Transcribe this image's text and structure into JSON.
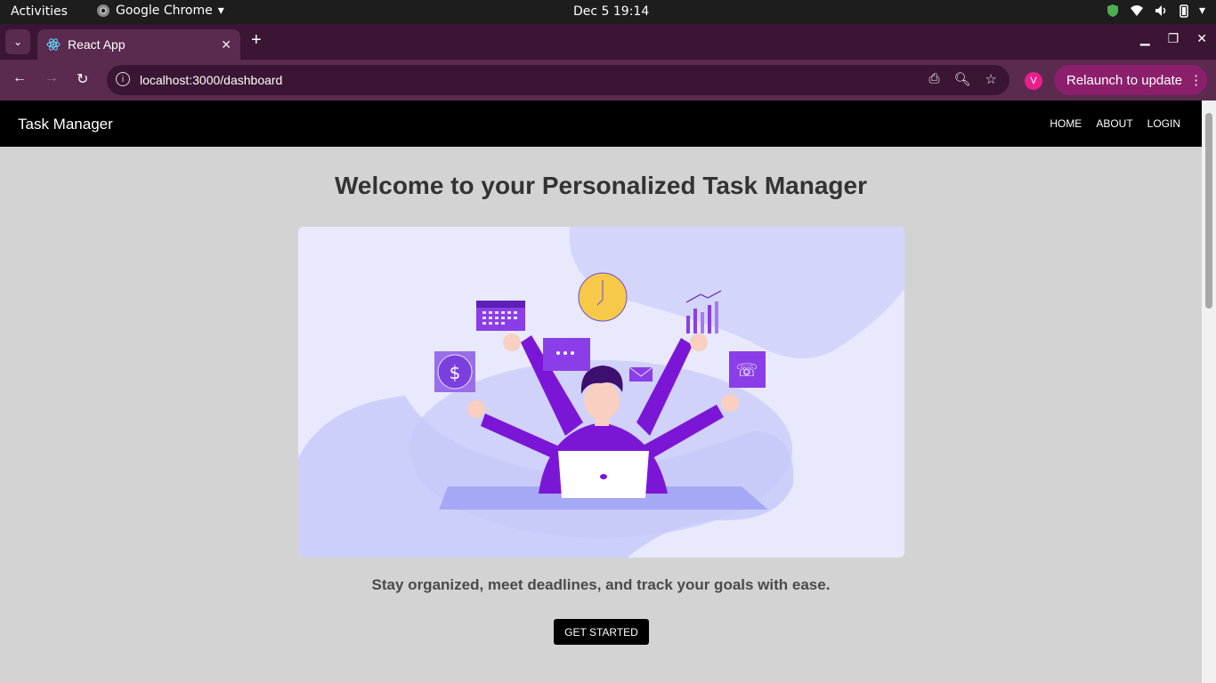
{
  "os": {
    "activities_label": "Activities",
    "app_name": "Google Chrome",
    "clock": "Dec 5  19:14"
  },
  "browser": {
    "tab_title": "React App",
    "url": "localhost:3000/dashboard",
    "avatar_letter": "V",
    "relaunch_label": "Relaunch to update"
  },
  "navbar": {
    "brand": "Task Manager",
    "links": [
      "HOME",
      "ABOUT",
      "LOGIN"
    ]
  },
  "main": {
    "heading": "Welcome to your Personalized Task Manager",
    "tagline": "Stay organized, meet deadlines, and track your goals with ease.",
    "cta_label": "GET STARTED"
  },
  "colors": {
    "accent_purple": "#7b2fd9",
    "navbar_bg": "#000000",
    "page_bg": "#d3d3d3"
  }
}
